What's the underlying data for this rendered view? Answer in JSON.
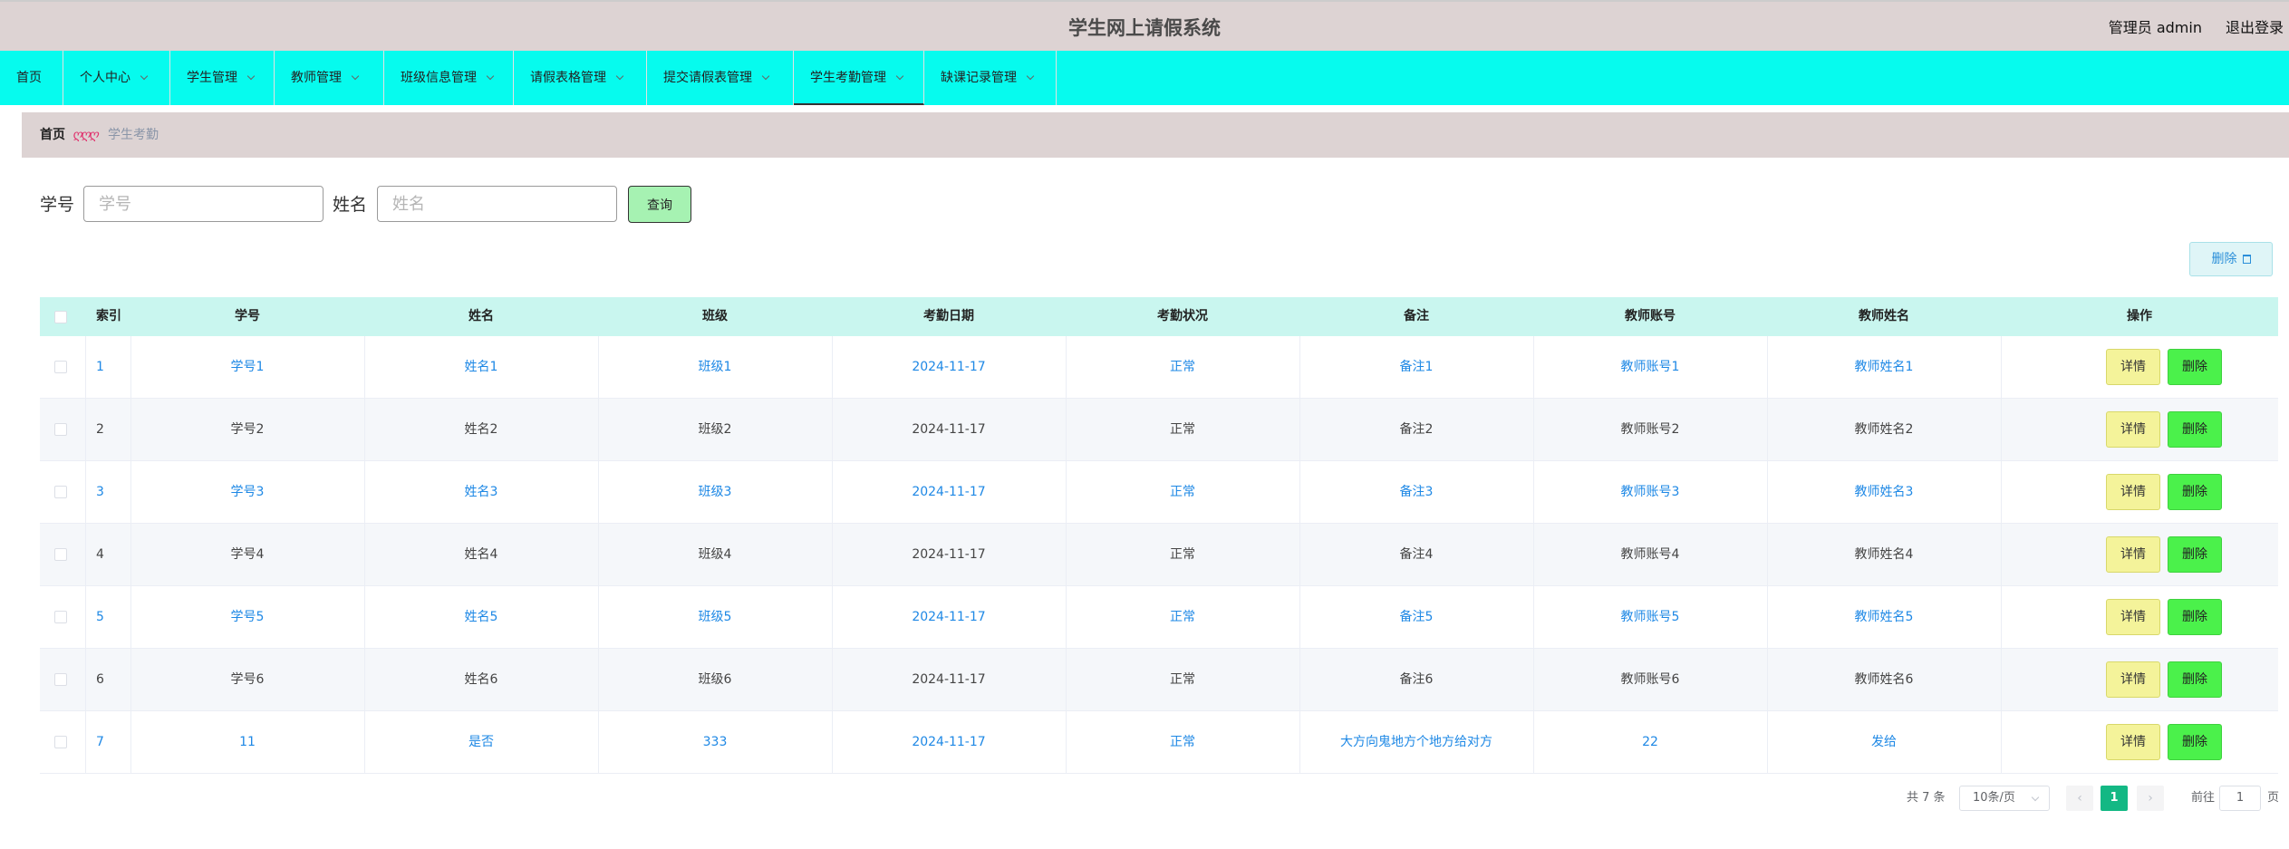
{
  "header": {
    "title": "学生网上请假系统",
    "user_label": "管理员 admin",
    "logout_label": "退出登录"
  },
  "nav": {
    "items": [
      {
        "label": "首页",
        "has_dropdown": false
      },
      {
        "label": "个人中心",
        "has_dropdown": true
      },
      {
        "label": "学生管理",
        "has_dropdown": true
      },
      {
        "label": "教师管理",
        "has_dropdown": true
      },
      {
        "label": "班级信息管理",
        "has_dropdown": true
      },
      {
        "label": "请假表格管理",
        "has_dropdown": true
      },
      {
        "label": "提交请假表管理",
        "has_dropdown": true
      },
      {
        "label": "学生考勤管理",
        "has_dropdown": true,
        "active": true
      },
      {
        "label": "缺课记录管理",
        "has_dropdown": true
      }
    ]
  },
  "breadcrumb": {
    "home": "首页",
    "separator": "ღღღ",
    "current": "学生考勤"
  },
  "search": {
    "student_id_label": "学号",
    "student_id_placeholder": "学号",
    "name_label": "姓名",
    "name_placeholder": "姓名",
    "query_button": "查询"
  },
  "toolbar": {
    "batch_delete_label": "删除"
  },
  "table": {
    "columns": [
      "索引",
      "学号",
      "姓名",
      "班级",
      "考勤日期",
      "考勤状况",
      "备注",
      "教师账号",
      "教师姓名",
      "操作"
    ],
    "rows": [
      {
        "index": "1",
        "student_id": "学号1",
        "name": "姓名1",
        "class": "班级1",
        "date": "2024-11-17",
        "status": "正常",
        "remark": "备注1",
        "teacher_account": "教师账号1",
        "teacher_name": "教师姓名1"
      },
      {
        "index": "2",
        "student_id": "学号2",
        "name": "姓名2",
        "class": "班级2",
        "date": "2024-11-17",
        "status": "正常",
        "remark": "备注2",
        "teacher_account": "教师账号2",
        "teacher_name": "教师姓名2"
      },
      {
        "index": "3",
        "student_id": "学号3",
        "name": "姓名3",
        "class": "班级3",
        "date": "2024-11-17",
        "status": "正常",
        "remark": "备注3",
        "teacher_account": "教师账号3",
        "teacher_name": "教师姓名3"
      },
      {
        "index": "4",
        "student_id": "学号4",
        "name": "姓名4",
        "class": "班级4",
        "date": "2024-11-17",
        "status": "正常",
        "remark": "备注4",
        "teacher_account": "教师账号4",
        "teacher_name": "教师姓名4"
      },
      {
        "index": "5",
        "student_id": "学号5",
        "name": "姓名5",
        "class": "班级5",
        "date": "2024-11-17",
        "status": "正常",
        "remark": "备注5",
        "teacher_account": "教师账号5",
        "teacher_name": "教师姓名5"
      },
      {
        "index": "6",
        "student_id": "学号6",
        "name": "姓名6",
        "class": "班级6",
        "date": "2024-11-17",
        "status": "正常",
        "remark": "备注6",
        "teacher_account": "教师账号6",
        "teacher_name": "教师姓名6"
      },
      {
        "index": "7",
        "student_id": "11",
        "name": "是否",
        "class": "333",
        "date": "2024-11-17",
        "status": "正常",
        "remark": "大方向鬼地方个地方给对方",
        "teacher_account": "22",
        "teacher_name": "发给"
      }
    ],
    "detail_label": "详情",
    "delete_label": "删除"
  },
  "pagination": {
    "total_label": "共 7 条",
    "page_size_label": "10条/页",
    "current_page": "1",
    "goto_label": "前往",
    "goto_value": "1",
    "goto_unit": "页"
  },
  "colors": {
    "nav_bg": "#06fbee",
    "header_bg": "#ddd3d3",
    "table_head_bg": "#c9f6ef",
    "link_blue": "#1e88e5",
    "detail_btn": "#f4f39a",
    "delete_btn": "#4bf14b",
    "page_active": "#13b884"
  }
}
